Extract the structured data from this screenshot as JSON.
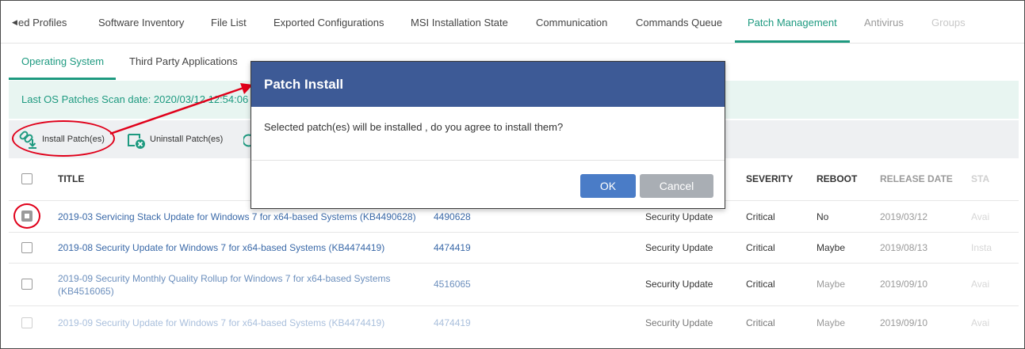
{
  "top_tabs": {
    "items": [
      {
        "label": "ed Profiles",
        "state": "normal"
      },
      {
        "label": "Software Inventory",
        "state": "normal"
      },
      {
        "label": "File List",
        "state": "normal"
      },
      {
        "label": "Exported Configurations",
        "state": "normal"
      },
      {
        "label": "MSI Installation State",
        "state": "normal"
      },
      {
        "label": "Communication",
        "state": "normal"
      },
      {
        "label": "Commands Queue",
        "state": "normal"
      },
      {
        "label": "Patch Management",
        "state": "active"
      },
      {
        "label": "Antivirus",
        "state": "faded"
      },
      {
        "label": "Groups",
        "state": "faded2"
      }
    ],
    "scroll_left_icon": "caret-left-icon"
  },
  "sub_tabs": {
    "items": [
      {
        "label": "Operating System",
        "state": "active"
      },
      {
        "label": "Third Party Applications",
        "state": "normal"
      }
    ]
  },
  "scan_bar": {
    "text": "Last OS Patches Scan date: 2020/03/12 12:54:06"
  },
  "toolbar": {
    "install_label": "Install Patch(es)",
    "install_icon": "install-patch-icon",
    "uninstall_label": "Uninstall Patch(es)",
    "uninstall_icon": "uninstall-patch-icon",
    "third_icon": "refresh-icon"
  },
  "table": {
    "headers": {
      "title": "TITLE",
      "severity": "SEVERITY",
      "reboot": "REBOOT",
      "release_date": "RELEASE DATE",
      "status": "STA"
    },
    "rows": [
      {
        "title": "2019-03 Servicing Stack Update for Windows 7 for x64-based Systems (KB4490628)",
        "kb": "4490628",
        "category": "Security Update",
        "severity": "Critical",
        "reboot": "No",
        "release_date": "2019/03/12",
        "status": "Avai",
        "checked": true
      },
      {
        "title": "2019-08 Security Update for Windows 7 for x64-based Systems (KB4474419)",
        "kb": "4474419",
        "category": "Security Update",
        "severity": "Critical",
        "reboot": "Maybe",
        "release_date": "2019/08/13",
        "status": "Insta",
        "checked": false
      },
      {
        "title": "2019-09 Security Monthly Quality Rollup for Windows 7 for x64-based Systems (KB4516065)",
        "kb": "4516065",
        "category": "Security Update",
        "severity": "Critical",
        "reboot": "Maybe",
        "release_date": "2019/09/10",
        "status": "Avai",
        "checked": false
      },
      {
        "title": "2019-09 Security Update for Windows 7 for x64-based Systems (KB4474419)",
        "kb": "4474419",
        "category": "Security Update",
        "severity": "Critical",
        "reboot": "Maybe",
        "release_date": "2019/09/10",
        "status": "Avai",
        "checked": false
      }
    ]
  },
  "modal": {
    "title": "Patch Install",
    "message": "Selected patch(es) will be installed , do you agree to install them?",
    "ok_label": "OK",
    "cancel_label": "Cancel"
  },
  "colors": {
    "accent": "#1e9a80",
    "modal_header": "#3d5a96",
    "ok_button": "#4a7cc7",
    "cancel_button": "#a9aeb4",
    "annotation": "#e0001a",
    "link": "#3a69a8"
  }
}
